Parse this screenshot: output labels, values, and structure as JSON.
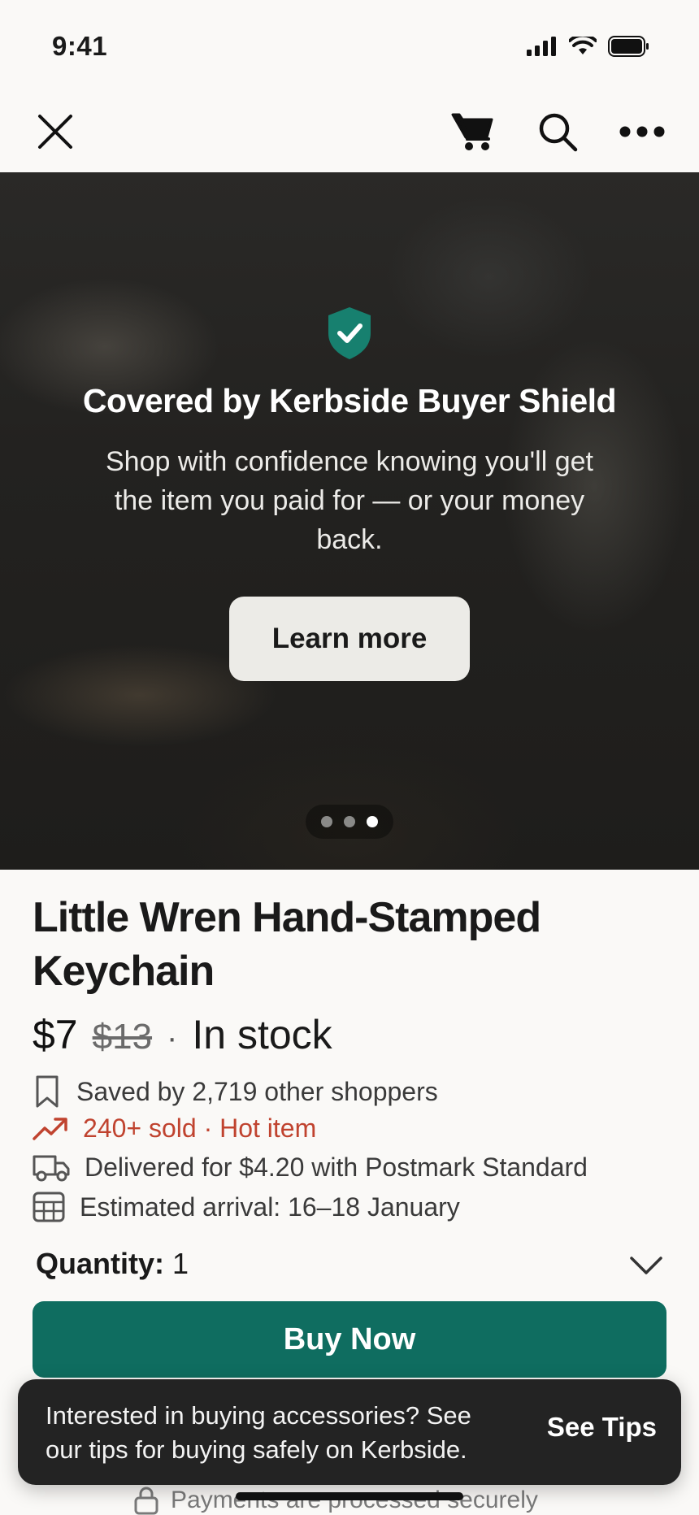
{
  "status_bar": {
    "time": "9:41"
  },
  "hero": {
    "title": "Covered by Kerbside Buyer Shield",
    "description": "Shop with confidence knowing you'll get the item you paid for — or your money back.",
    "button_label": "Learn more",
    "carousel": {
      "total": 3,
      "active": 3
    },
    "shield_color": "#17806f"
  },
  "product": {
    "title": "Little Wren Hand-Stamped Keychain",
    "price": "$7",
    "original_price": "$13",
    "separator": "·",
    "stock": "In stock",
    "details": {
      "saved": "Saved by 2,719 other shoppers",
      "sold": "240+ sold · Hot item",
      "delivery": "Delivered for $4.20 with Postmark Standard",
      "arrival": "Estimated arrival: 16–18 January"
    },
    "quantity_label": "Quantity:",
    "quantity_value": "1"
  },
  "buy_button": {
    "label": "Buy Now",
    "color": "#0f6d60"
  },
  "toast": {
    "text": "Interested in buying accessories? See our tips for buying safely on Kerbside.",
    "action": "See Tips"
  },
  "footer": {
    "secure_text": "Payments are processed securely"
  },
  "colors": {
    "accent": "#0f6d60",
    "hot": "#c0432f"
  }
}
